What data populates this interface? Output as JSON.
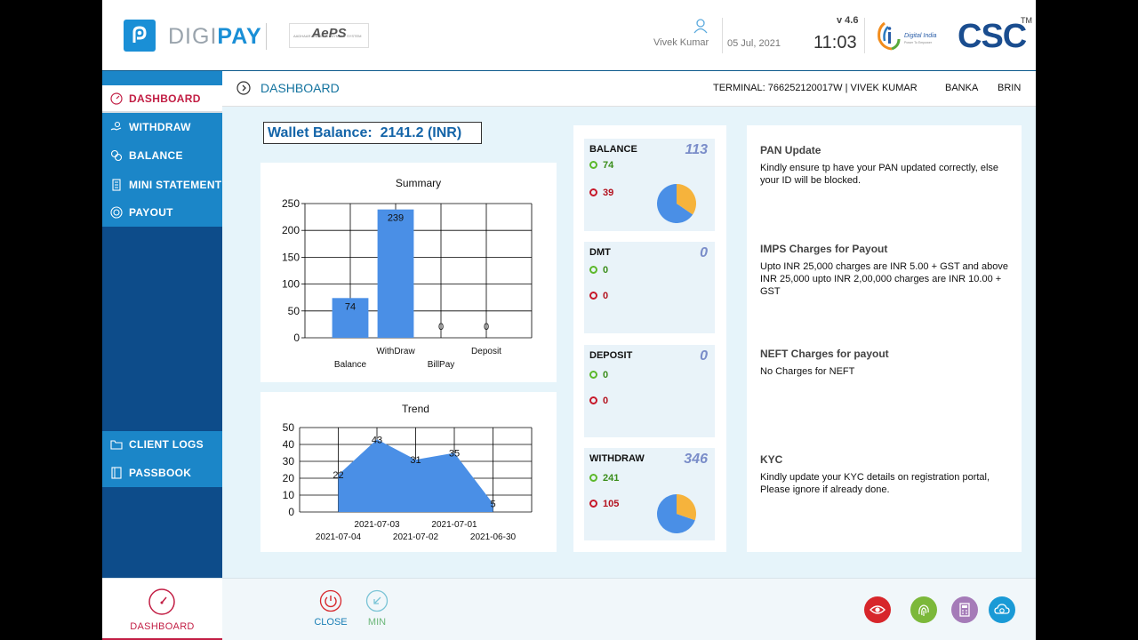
{
  "header": {
    "brand_prefix": "DIGI",
    "brand_suffix": "PAY",
    "aeps_logo": "AePS",
    "aeps_tagline": "AADHAAR ENABLED PAYMENT SYSTEM",
    "user_name": "Vivek Kumar",
    "date": "05 Jul, 2021",
    "version": "v 4.6",
    "time": "11:03",
    "digital_india": "Digital India",
    "digital_india_tagline": "Power To Empower",
    "csc_logo": "CSC",
    "csc_tm": "TM"
  },
  "sidebar": {
    "items": [
      {
        "label": "DASHBOARD",
        "icon": "gauge-icon"
      },
      {
        "label": "WITHDRAW",
        "icon": "hand-cash-icon"
      },
      {
        "label": "BALANCE",
        "icon": "coins-icon"
      },
      {
        "label": "MINI STATEMENT",
        "icon": "receipt-icon"
      },
      {
        "label": "PAYOUT",
        "icon": "payout-icon"
      }
    ],
    "bottom_items": [
      {
        "label": "CLIENT LOGS",
        "icon": "folder-icon"
      },
      {
        "label": "PASSBOOK",
        "icon": "book-icon"
      }
    ]
  },
  "topbar": {
    "title": "DASHBOARD",
    "terminal": "TERMINAL: 766252120017W | VIVEK KUMAR",
    "bank": "BANKA",
    "brin": "BRIN"
  },
  "wallet": {
    "label": "Wallet Balance:",
    "value": "2141.2 (INR)"
  },
  "chart_data": [
    {
      "type": "bar",
      "title": "Summary",
      "categories": [
        "Balance",
        "WithDraw",
        "BillPay",
        "Deposit"
      ],
      "values": [
        74,
        239,
        0,
        0
      ],
      "ylim": [
        0,
        250
      ],
      "yticks": [
        0,
        50,
        100,
        150,
        200,
        250
      ],
      "grid": true,
      "color": "#4a8fe6"
    },
    {
      "type": "area",
      "title": "Trend",
      "x": [
        "2021-07-04",
        "2021-07-03",
        "2021-07-02",
        "2021-07-01",
        "2021-06-30"
      ],
      "values": [
        22,
        43,
        31,
        35,
        5
      ],
      "ylim": [
        0,
        50
      ],
      "yticks": [
        0,
        10,
        20,
        30,
        40,
        50
      ],
      "grid": true,
      "color": "#4a8fe6"
    }
  ],
  "stats": [
    {
      "title": "BALANCE",
      "total": "113",
      "success": "74",
      "failed": "39",
      "pie": [
        74,
        39
      ]
    },
    {
      "title": "DMT",
      "total": "0",
      "success": "0",
      "failed": "0"
    },
    {
      "title": "DEPOSIT",
      "total": "0",
      "success": "0",
      "failed": "0"
    },
    {
      "title": "WITHDRAW",
      "total": "346",
      "success": "241",
      "failed": "105",
      "pie": [
        241,
        105
      ]
    }
  ],
  "stat_colors": {
    "success": "#4a8fe6",
    "failed": "#f6b33c"
  },
  "notices": [
    {
      "title": "PAN Update",
      "text": "Kindly ensure tp have your PAN updated correctly, else your ID will be blocked."
    },
    {
      "title": "IMPS Charges for Payout",
      "text": "Upto INR 25,000 charges are INR 5.00 + GST and above INR 25,000 upto INR 2,00,000 charges are INR 10.00 + GST"
    },
    {
      "title": "NEFT Charges for payout",
      "text": "No Charges for NEFT"
    },
    {
      "title": "KYC",
      "text": "Kindly update your KYC details on registration portal, Please ignore if already done."
    }
  ],
  "footer": {
    "dashboard_label": "DASHBOARD",
    "close_label": "CLOSE",
    "min_label": "MIN",
    "round_buttons": [
      {
        "icon": "eye-icon",
        "color": "#d7262b"
      },
      {
        "icon": "fingerprint-icon",
        "color": "#7cb83a"
      },
      {
        "icon": "calculator-icon",
        "color": "#a57bb8"
      },
      {
        "icon": "cloud-sync-icon",
        "color": "#1a9ad6"
      }
    ]
  }
}
